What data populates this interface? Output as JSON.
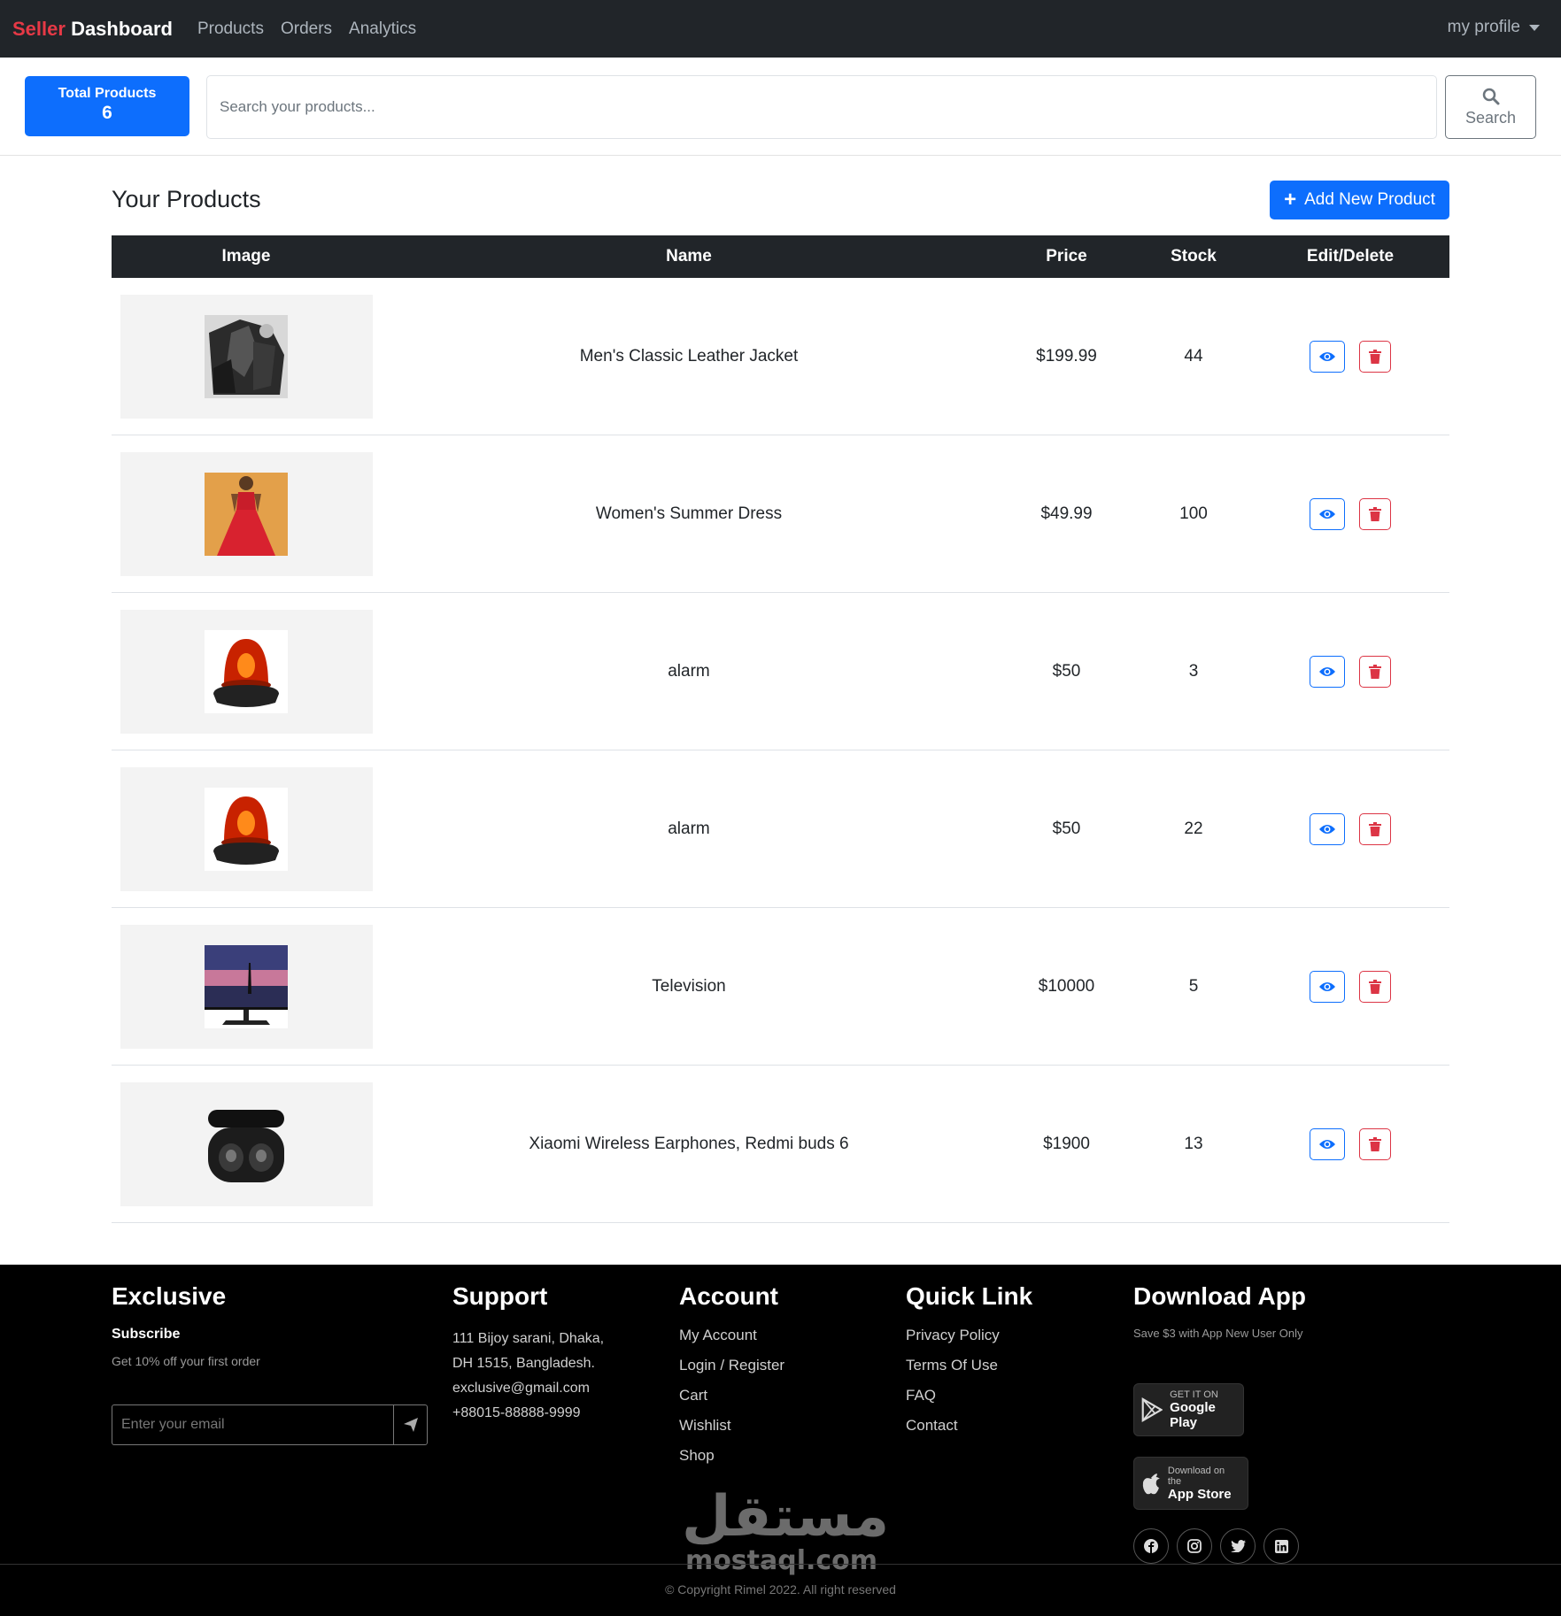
{
  "navbar": {
    "brand_part1": "Seller",
    "brand_part2": "Dashboard",
    "links": [
      "Products",
      "Orders",
      "Analytics"
    ],
    "profile_label": "my profile"
  },
  "topbar": {
    "total_label": "Total Products",
    "total_value": "6",
    "search_placeholder": "Search your products...",
    "search_button": "Search"
  },
  "products": {
    "title": "Your Products",
    "add_button": "Add New Product",
    "columns": [
      "Image",
      "Name",
      "Price",
      "Stock",
      "Edit/Delete"
    ],
    "rows": [
      {
        "name": "Men's Classic Leather Jacket",
        "price": "$199.99",
        "stock": "44",
        "image_icon": "leather-jacket-image"
      },
      {
        "name": "Women's Summer Dress",
        "price": "$49.99",
        "stock": "100",
        "image_icon": "summer-dress-image"
      },
      {
        "name": "alarm",
        "price": "$50",
        "stock": "3",
        "image_icon": "alarm-light-image"
      },
      {
        "name": "alarm",
        "price": "$50",
        "stock": "22",
        "image_icon": "alarm-light-image"
      },
      {
        "name": "Television",
        "price": "$10000",
        "stock": "5",
        "image_icon": "monitor-image"
      },
      {
        "name": "Xiaomi Wireless Earphones, Redmi buds 6",
        "price": "$1900",
        "stock": "13",
        "image_icon": "earbuds-image"
      }
    ]
  },
  "footer": {
    "exclusive": {
      "title": "Exclusive",
      "subscribe": "Subscribe",
      "offer": "Get 10% off your first order",
      "email_placeholder": "Enter your email"
    },
    "support": {
      "title": "Support",
      "address_line1": "111 Bijoy sarani, Dhaka,",
      "address_line2": "DH 1515, Bangladesh.",
      "email": "exclusive@gmail.com",
      "phone": "+88015-88888-9999"
    },
    "account": {
      "title": "Account",
      "links": [
        "My Account",
        "Login / Register",
        "Cart",
        "Wishlist",
        "Shop"
      ]
    },
    "quick_link": {
      "title": "Quick Link",
      "links": [
        "Privacy Policy",
        "Terms Of Use",
        "FAQ",
        "Contact"
      ]
    },
    "download": {
      "title": "Download App",
      "note": "Save $3 with App New User Only",
      "google_small": "GET IT ON",
      "google_big": "Google Play",
      "apple_small": "Download on the",
      "apple_big": "App Store"
    },
    "social_icons": [
      "facebook-icon",
      "instagram-icon",
      "twitter-icon",
      "linkedin-icon"
    ],
    "copyright": "© Copyright Rimel 2022. All right reserved",
    "watermark_ar": "مستقل",
    "watermark_lat": "mostaql.com"
  },
  "colors": {
    "primary": "#0d6efd",
    "danger": "#dc3545",
    "brand_red": "#e63946",
    "navbar_bg": "#212529",
    "footer_bg": "#000000"
  }
}
